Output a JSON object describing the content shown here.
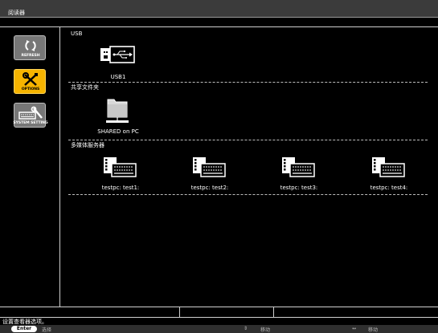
{
  "window": {
    "title": "阅读器"
  },
  "sidebar": {
    "items": [
      {
        "label": "REFRESH",
        "icon": "refresh-icon"
      },
      {
        "label": "OPTIONS",
        "icon": "tools-icon"
      },
      {
        "label": "SYSTEM SETTING",
        "icon": "system-setting-icon"
      }
    ]
  },
  "sections": {
    "usb": {
      "title": "USB",
      "items": [
        {
          "label": "USB1",
          "icon": "usb-drive-icon"
        }
      ]
    },
    "shared": {
      "title": "共享文件夹",
      "items": [
        {
          "label": "SHARED on PC",
          "icon": "pc-folder-icon"
        }
      ]
    },
    "media": {
      "title": "多媒体服务器",
      "items": [
        {
          "label": "testpc: test1:",
          "icon": "media-server-icon"
        },
        {
          "label": "testpc: test2:",
          "icon": "media-server-icon"
        },
        {
          "label": "testpc: test3:",
          "icon": "media-server-icon"
        },
        {
          "label": "testpc: test4:",
          "icon": "media-server-icon"
        }
      ]
    }
  },
  "status": {
    "message": "设置查看器选项。"
  },
  "footer": {
    "enter_key": "Enter",
    "enter_action": "选择",
    "updown_symbol": "⇕",
    "updown_action": "移动",
    "leftright_symbol": "↔",
    "leftright_action": "移动"
  },
  "colors": {
    "accent": "#f6b400",
    "button": "#777777",
    "background": "#000000"
  }
}
